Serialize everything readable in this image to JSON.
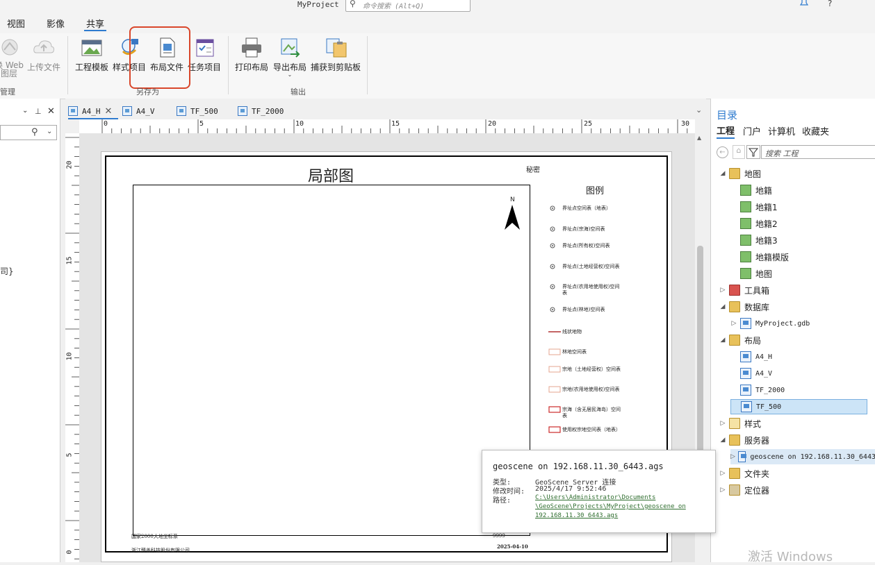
{
  "app": {
    "title": "MyProject",
    "command_search_placeholder": "命令搜索 (Alt+Q)",
    "help_label": "?"
  },
  "ribbon_tabs": [
    "视图",
    "影像",
    "共享"
  ],
  "ribbon": {
    "manage_group": {
      "label": "管理",
      "btn_web_layer": "换 Web\n图层",
      "btn_upload": "上传文件"
    },
    "save_as_group": {
      "label": "另存为",
      "buttons": [
        "工程模板",
        "样式项目",
        "布局文件",
        "任务项目"
      ],
      "highlighted": "布局文件"
    },
    "output_group": {
      "label": "输出",
      "buttons": [
        "打印布局",
        "导出布局",
        "捕获到剪贴板"
      ]
    }
  },
  "left_pane": {
    "partial_text": "司}"
  },
  "doc_tabs": [
    "A4_H",
    "A4_V",
    "TF_500",
    "TF_2000"
  ],
  "rulers": {
    "h_ticks": [
      "0",
      "5",
      "10",
      "15",
      "20",
      "25",
      "30"
    ],
    "v_ticks": [
      "20",
      "15",
      "10",
      "5",
      "0"
    ]
  },
  "layout_page": {
    "title": "局部图",
    "secret": "秘密",
    "north_label": "N",
    "legend_title": "图例",
    "legend_items": [
      {
        "label": "界址点空间表（地表）",
        "symbol": "point"
      },
      {
        "label": "界址点(宗海)空间表",
        "symbol": "point"
      },
      {
        "label": "界址点(所有权)空间表",
        "symbol": "point"
      },
      {
        "label": "界址点(土地经营权)空间表",
        "symbol": "point"
      },
      {
        "label": "界址点(农用地使用权)空间表",
        "symbol": "point"
      },
      {
        "label": "界址点(林地)空间表",
        "symbol": "point"
      },
      {
        "label": "线状地物",
        "symbol": "line"
      },
      {
        "label": "林地空间表",
        "symbol": "polygon-light"
      },
      {
        "label": "宗地（土地经营权）空间表",
        "symbol": "polygon-light"
      },
      {
        "label": "宗地(农用地使用权)空间表",
        "symbol": "polygon-light"
      },
      {
        "label": "宗海（含无居民海岛）空间表",
        "symbol": "polygon-red"
      },
      {
        "label": "使用权宗地空间表（地表）",
        "symbol": "polygon-red"
      }
    ],
    "footer_left1": "国家2000大地坐标系",
    "footer_left2": "浙江臻善科技股份有限公司",
    "footer_right1": "9999",
    "footer_date": "2025-04-10"
  },
  "catalog": {
    "title": "目录",
    "tabs": [
      "工程",
      "门户",
      "计算机",
      "收藏夹"
    ],
    "search_placeholder": "搜索 工程",
    "tree": [
      {
        "label": "地图",
        "icon": "folder-icon",
        "level": 0,
        "expanded": true
      },
      {
        "label": "地籍",
        "icon": "map-icon",
        "level": 1
      },
      {
        "label": "地籍1",
        "icon": "map-icon",
        "level": 1
      },
      {
        "label": "地籍2",
        "icon": "map-icon",
        "level": 1
      },
      {
        "label": "地籍3",
        "icon": "map-icon",
        "level": 1
      },
      {
        "label": "地籍模版",
        "icon": "map-icon",
        "level": 1
      },
      {
        "label": "地图",
        "icon": "map-icon",
        "level": 1
      },
      {
        "label": "工具箱",
        "icon": "toolbox-icon",
        "level": 0,
        "expanded": false
      },
      {
        "label": "数据库",
        "icon": "folder-icon",
        "level": 0,
        "expanded": true
      },
      {
        "label": "MyProject.gdb",
        "icon": "gdb-icon",
        "level": 1,
        "mono": true
      },
      {
        "label": "布局",
        "icon": "folder-icon",
        "level": 0,
        "expanded": true
      },
      {
        "label": "A4_H",
        "icon": "layout-icon",
        "level": 1,
        "mono": true
      },
      {
        "label": "A4_V",
        "icon": "layout-icon",
        "level": 1,
        "mono": true
      },
      {
        "label": "TF_2000",
        "icon": "layout-icon",
        "level": 1,
        "mono": true
      },
      {
        "label": "TF_500",
        "icon": "layout-icon",
        "level": 1,
        "mono": true,
        "selected": true
      },
      {
        "label": "样式",
        "icon": "style-icon",
        "level": 0,
        "expanded": false
      },
      {
        "label": "服务器",
        "icon": "folder-icon",
        "level": 0,
        "expanded": true
      },
      {
        "label": "geoscene on 192.168.11.30_6443",
        "icon": "server-icon",
        "level": 1,
        "mono": true,
        "selected_soft": true
      },
      {
        "label": "文件夹",
        "icon": "folder-icon",
        "level": 0,
        "expanded": false
      },
      {
        "label": "定位器",
        "icon": "locator-icon",
        "level": 0,
        "expanded": false
      }
    ]
  },
  "tooltip": {
    "title": "geoscene on 192.168.11.30_6443.ags",
    "type_key": "类型:",
    "type_val": "GeoScene Server 连接",
    "modified_key": "修改时间:",
    "modified_val": "2025/4/17 9:52:46",
    "path_key": "路径:",
    "path_line1": "C:\\Users\\Administrator\\Documents",
    "path_line2": "\\GeoScene\\Projects\\MyProject\\geoscene on",
    "path_line3": "192.168.11.30_6443.ags"
  },
  "watermark": "激活 Windows",
  "colors": {
    "accent": "#2e7bcf",
    "highlight_box": "#d9462a",
    "selected_row": "#cce4f7"
  }
}
